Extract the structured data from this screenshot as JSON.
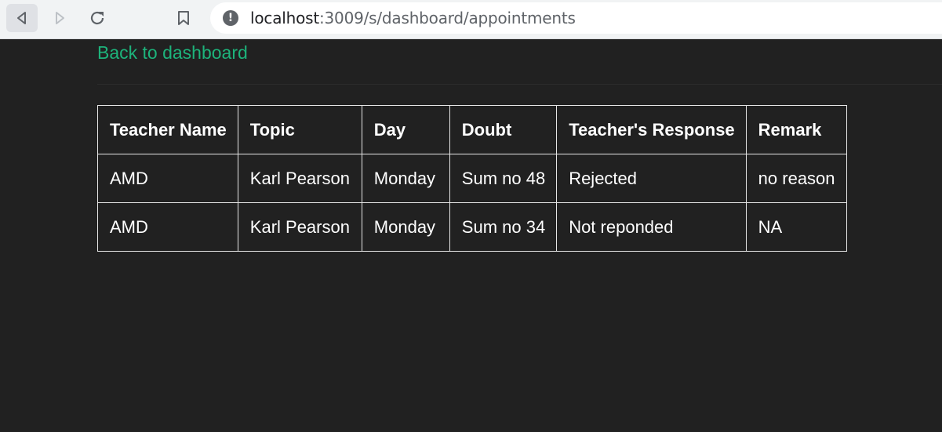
{
  "browser": {
    "url_host": "localhost",
    "url_path": ":3009/s/dashboard/appointments",
    "icons": {
      "back": "back-arrow-icon",
      "forward": "forward-arrow-icon",
      "reload": "reload-icon",
      "bookmark": "bookmark-icon",
      "site_info": "site-info-icon"
    }
  },
  "page": {
    "back_link": "Back to dashboard",
    "link_color": "#1db37b",
    "background": "#212121"
  },
  "table": {
    "headers": [
      "Teacher Name",
      "Topic",
      "Day",
      "Doubt",
      "Teacher's Response",
      "Remark"
    ],
    "rows": [
      [
        "AMD",
        "Karl Pearson",
        "Monday",
        "Sum no 48",
        "Rejected",
        "no reason"
      ],
      [
        "AMD",
        "Karl Pearson",
        "Monday",
        "Sum no 34",
        "Not reponded",
        "NA"
      ]
    ]
  }
}
